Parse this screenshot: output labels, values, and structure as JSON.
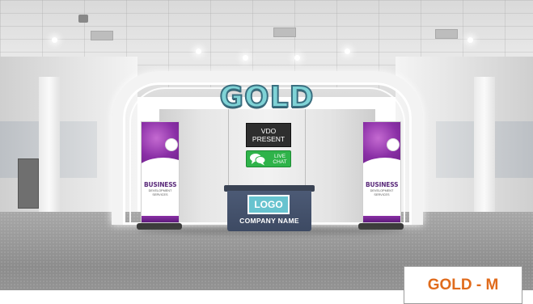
{
  "booth": {
    "title": "GOLD",
    "vdo_button": {
      "line1": "VDO",
      "line2": "PRESENT"
    },
    "chat_button": {
      "line1": "LIVE",
      "line2": "CHAT",
      "icon": "chat-bubbles-icon"
    },
    "logo_text": "LOGO",
    "company_text": "COMPANY NAME"
  },
  "banners": [
    {
      "heading": "BUSINESS",
      "sub1": "DEVELOPMENT",
      "sub2": "SERVICES"
    },
    {
      "heading": "BUSINESS",
      "sub1": "DEVELOPMENT",
      "sub2": "SERVICES"
    }
  ],
  "tier_label": "GOLD - M",
  "colors": {
    "title_fill": "#7fd3d6",
    "chat_green": "#2fb34a",
    "counter_navy": "#3d4a63",
    "logo_teal": "#67c3cf",
    "tier_orange": "#e06b1c",
    "banner_purple": "#8a2fa6"
  }
}
